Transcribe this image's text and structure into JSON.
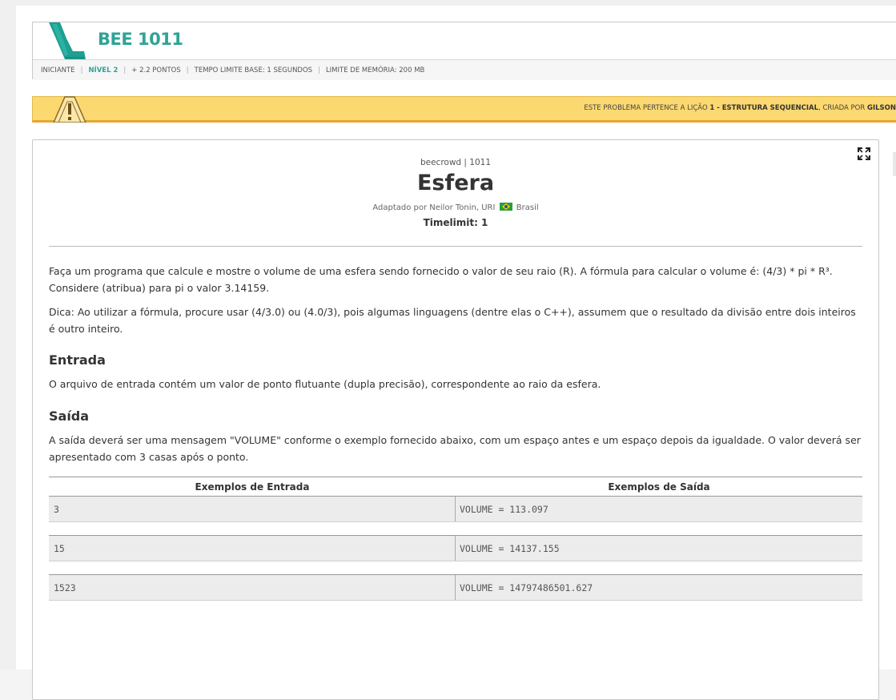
{
  "header": {
    "title": "BEE 1011",
    "meta": {
      "category": "INICIANTE",
      "level": "NÍVEL 2",
      "points": "+ 2.2 PONTOS",
      "time_limit": "TEMPO LIMITE BASE: 1 SEGUNDOS",
      "memory_limit": "LIMITE DE MEMÓRIA: 200 MB"
    }
  },
  "banner": {
    "prefix": "ESTE PROBLEMA PERTENCE A LIÇÃO",
    "lesson_number": "1 - ESTRUTURA SEQUENCIAL",
    "middle": ", CRIADA POR",
    "author": "GILSON"
  },
  "problem": {
    "source": "beecrowd | 1011",
    "title": "Esfera",
    "adapted_by": "Adaptado por Neilor Tonin, URI",
    "country": "Brasil",
    "timelimit": "Timelimit: 1",
    "description_1": "Faça um programa que calcule e mostre o volume de uma esfera sendo fornecido o valor de seu raio (R). A fórmula para calcular o volume é: (4/3) * pi * R³. Considere (atribua) para pi o valor 3.14159.",
    "description_2": "Dica: Ao utilizar a fórmula, procure usar (4/3.0) ou (4.0/3), pois algumas linguagens (dentre elas o C++), assumem que o resultado da divisão entre dois inteiros é outro inteiro.",
    "input_heading": "Entrada",
    "input_text": "O arquivo de entrada contém um valor de ponto flutuante (dupla precisão), correspondente ao raio da esfera.",
    "output_heading": "Saída",
    "output_text": "A saída deverá ser uma mensagem \"VOLUME\" conforme o exemplo fornecido abaixo, com um espaço antes e um espaço depois da igualdade. O valor deverá ser apresentado com 3 casas após o ponto."
  },
  "examples": {
    "input_header": "Exemplos de Entrada",
    "output_header": "Exemplos de Saída",
    "rows": [
      {
        "input": "3",
        "output": "VOLUME = 113.097"
      },
      {
        "input": "15",
        "output": "VOLUME = 14137.155"
      },
      {
        "input": "1523",
        "output": "VOLUME = 14797486501.627"
      }
    ]
  },
  "colors": {
    "accent": "#2fa397",
    "banner": "#fcd870"
  },
  "icons": [
    "logo-mark",
    "warning-sign-icon",
    "expand-icon",
    "brazil-flag-icon"
  ]
}
